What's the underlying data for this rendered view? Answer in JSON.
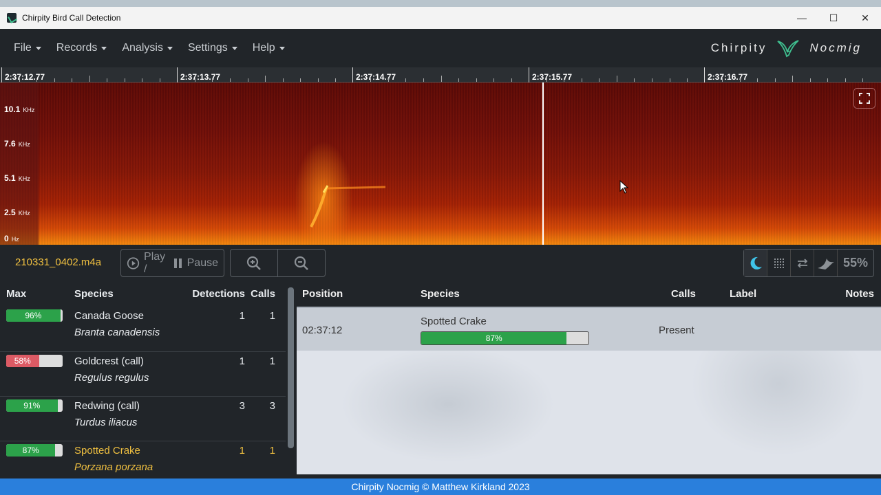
{
  "window": {
    "title": "Chirpity Bird Call Detection",
    "controls": [
      "—",
      "☐",
      "✕"
    ]
  },
  "menu": {
    "items": [
      "File",
      "Records",
      "Analysis",
      "Settings",
      "Help"
    ]
  },
  "brand": {
    "left": "Chirpity",
    "right": "Nocmig"
  },
  "timeline": {
    "ticks": [
      "2:37:12.77",
      "2:37:13.77",
      "2:37:14.77",
      "2:37:15.77",
      "2:37:16.77"
    ]
  },
  "frequency_axis": [
    {
      "value": "10.1",
      "unit": "KHz"
    },
    {
      "value": "7.6",
      "unit": "KHz"
    },
    {
      "value": "5.1",
      "unit": "KHz"
    },
    {
      "value": "2.5",
      "unit": "KHz"
    },
    {
      "value": "0",
      "unit": "Hz"
    }
  ],
  "controls": {
    "filename": "210331_0402.m4a",
    "play_label": "Play /",
    "pause_label": "Pause",
    "zoom_percent": "55%"
  },
  "summary": {
    "headers": {
      "max": "Max",
      "species": "Species",
      "detections": "Detections",
      "calls": "Calls"
    },
    "rows": [
      {
        "max": "96%",
        "max_value": 96,
        "color": "#2ca24a",
        "name": "Canada Goose",
        "sci": "Branta canadensis",
        "detections": "1",
        "calls": "1",
        "highlight": false
      },
      {
        "max": "58%",
        "max_value": 58,
        "color": "#dc5a64",
        "name": "Goldcrest (call)",
        "sci": "Regulus regulus",
        "detections": "1",
        "calls": "1",
        "highlight": false
      },
      {
        "max": "91%",
        "max_value": 91,
        "color": "#2ca24a",
        "name": "Redwing (call)",
        "sci": "Turdus iliacus",
        "detections": "3",
        "calls": "3",
        "highlight": false
      },
      {
        "max": "87%",
        "max_value": 87,
        "color": "#2ca24a",
        "name": "Spotted Crake",
        "sci": "Porzana porzana",
        "detections": "1",
        "calls": "1",
        "highlight": true
      }
    ]
  },
  "results": {
    "headers": {
      "position": "Position",
      "species": "Species",
      "calls": "Calls",
      "label": "Label",
      "notes": "Notes"
    },
    "rows": [
      {
        "position": "02:37:12",
        "species": "Spotted Crake",
        "confidence": "87%",
        "confidence_value": 87,
        "calls": "Present",
        "label": "",
        "notes": ""
      }
    ]
  },
  "footer": {
    "text": "Chirpity Nocmig © Matthew Kirkland 2023"
  }
}
